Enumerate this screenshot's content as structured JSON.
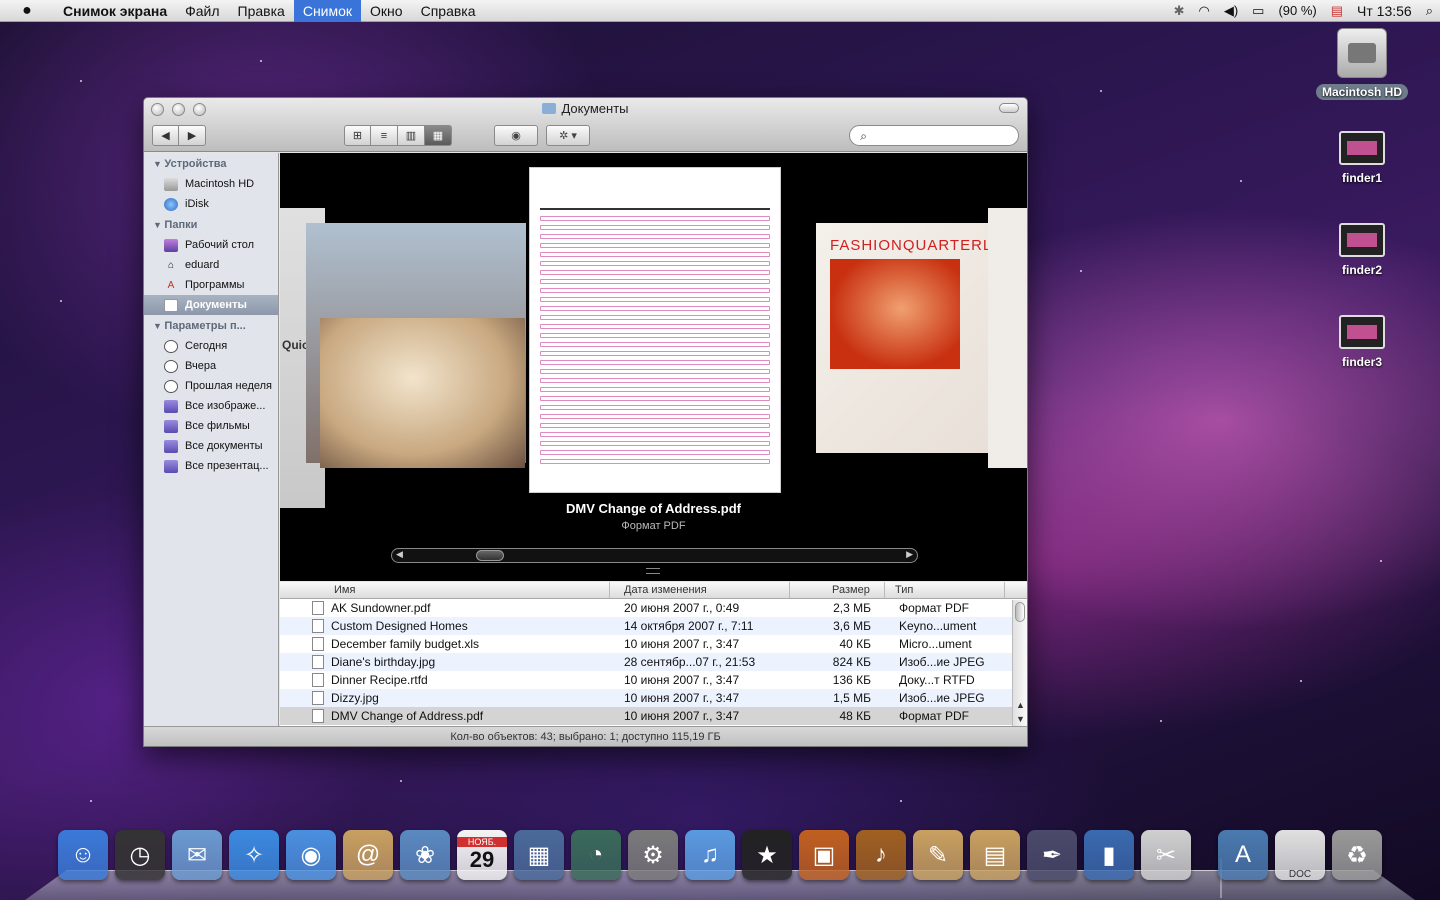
{
  "menubar": {
    "apple": "",
    "app_name": "Снимок экрана",
    "items": [
      "Файл",
      "Правка",
      "Снимок",
      "Окно",
      "Справка"
    ],
    "active_item": "Снимок",
    "battery": "(90 %)",
    "clock": "Чт 13:56"
  },
  "desktop": {
    "hd_label": "Macintosh HD",
    "icons": [
      "finder1",
      "finder2",
      "finder3"
    ]
  },
  "window": {
    "title": "Документы",
    "search_placeholder": "",
    "status": "Кол-во объектов: 43; выбрано: 1; доступно 115,19 ГБ"
  },
  "sidebar": {
    "sections": [
      {
        "title": "Устройства",
        "items": [
          {
            "label": "Macintosh HD",
            "icon": "disk-icon"
          },
          {
            "label": "iDisk",
            "icon": "globe-icon"
          }
        ]
      },
      {
        "title": "Папки",
        "items": [
          {
            "label": "Рабочий стол",
            "icon": "desktop-icon"
          },
          {
            "label": "eduard",
            "icon": "home-icon"
          },
          {
            "label": "Программы",
            "icon": "applications-icon"
          },
          {
            "label": "Документы",
            "icon": "documents-icon",
            "selected": true
          }
        ]
      },
      {
        "title": "Параметры п...",
        "items": [
          {
            "label": "Сегодня",
            "icon": "clock-icon"
          },
          {
            "label": "Вчера",
            "icon": "clock-icon"
          },
          {
            "label": "Прошлая неделя",
            "icon": "clock-icon"
          },
          {
            "label": "Все изображе...",
            "icon": "smart-folder-icon"
          },
          {
            "label": "Все фильмы",
            "icon": "smart-folder-icon"
          },
          {
            "label": "Все документы",
            "icon": "smart-folder-icon"
          },
          {
            "label": "Все презентац...",
            "icon": "smart-folder-icon"
          }
        ]
      }
    ]
  },
  "coverflow": {
    "selected_name": "DMV Change of Address.pdf",
    "selected_kind": "Формат PDF",
    "left_card_text": "Quiche",
    "right_card_text": "FASHIONQUARTERLY"
  },
  "list": {
    "columns": [
      "Имя",
      "Дата изменения",
      "Размер",
      "Тип"
    ],
    "rows": [
      {
        "name": "AK Sundowner.pdf",
        "date": "20 июня 2007 г., 0:49",
        "size": "2,3 МБ",
        "kind": "Формат PDF"
      },
      {
        "name": "Custom Designed Homes",
        "date": "14 октября 2007 г., 7:11",
        "size": "3,6 МБ",
        "kind": "Keyno...ument"
      },
      {
        "name": "December family budget.xls",
        "date": "10 июня 2007 г., 3:47",
        "size": "40 КБ",
        "kind": "Micro...ument"
      },
      {
        "name": "Diane's birthday.jpg",
        "date": "28 сентябр...07 г., 21:53",
        "size": "824 КБ",
        "kind": "Изоб...ие JPEG"
      },
      {
        "name": "Dinner Recipe.rtfd",
        "date": "10 июня 2007 г., 3:47",
        "size": "136 КБ",
        "kind": "Доку...т RTFD"
      },
      {
        "name": "Dizzy.jpg",
        "date": "10 июня 2007 г., 3:47",
        "size": "1,5 МБ",
        "kind": "Изоб...ие JPEG"
      },
      {
        "name": "DMV Change of Address.pdf",
        "date": "10 июня 2007 г., 3:47",
        "size": "48 КБ",
        "kind": "Формат PDF",
        "selected": true
      }
    ]
  },
  "dock": {
    "items": [
      {
        "name": "finder-icon",
        "color": "#3a7ad8"
      },
      {
        "name": "dashboard-icon",
        "color": "#333333"
      },
      {
        "name": "mail-icon",
        "color": "#6a9ad0"
      },
      {
        "name": "safari-icon",
        "color": "#3a8ae0"
      },
      {
        "name": "ichat-icon",
        "color": "#4a90e0"
      },
      {
        "name": "address-book-icon",
        "color": "#c8a060"
      },
      {
        "name": "iphoto-icon",
        "color": "#5a8ac0"
      },
      {
        "name": "ical-icon",
        "color": "#f4f4f4"
      },
      {
        "name": "spaces-icon",
        "color": "#4a6a9a"
      },
      {
        "name": "time-machine-icon",
        "color": "#3a6a5a"
      },
      {
        "name": "system-preferences-icon",
        "color": "#7a7a7a"
      },
      {
        "name": "itunes-icon",
        "color": "#5a9ae0"
      },
      {
        "name": "imovie-icon",
        "color": "#222222"
      },
      {
        "name": "iphoto-library-icon",
        "color": "#c06020"
      },
      {
        "name": "garageband-icon",
        "color": "#a06020"
      },
      {
        "name": "iweb-icon",
        "color": "#c8a060"
      },
      {
        "name": "keynote-icon",
        "color": "#c8a060"
      },
      {
        "name": "pages-icon",
        "color": "#4a4a6a"
      },
      {
        "name": "numbers-icon",
        "color": "#3a6ab0"
      },
      {
        "name": "grab-icon",
        "color": "#d0d0d0"
      },
      {
        "name": "applications-stack-icon",
        "color": "#4a7ab0"
      },
      {
        "name": "documents-stack-icon",
        "color": "#e0e0e0"
      },
      {
        "name": "trash-icon",
        "color": "#999999"
      }
    ],
    "doc_label": "DOC",
    "ical_month": "НОЯБ.",
    "ical_day": "29"
  }
}
